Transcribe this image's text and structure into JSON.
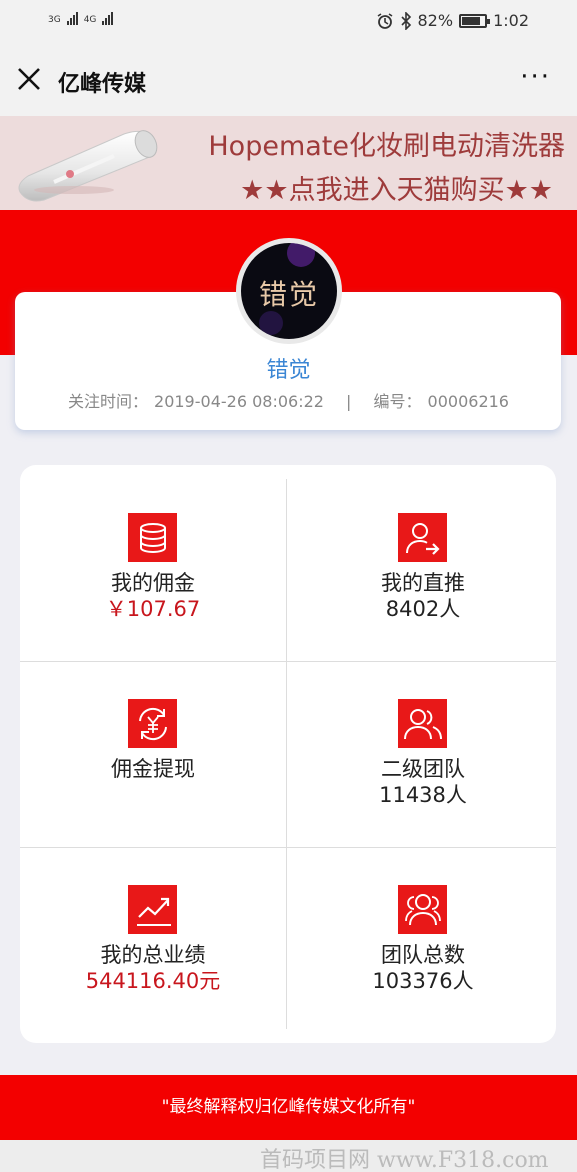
{
  "status_bar": {
    "network_1": "3G",
    "network_2": "4G",
    "battery": "82%",
    "battery_level": 0.82,
    "time": "1:02"
  },
  "nav": {
    "title": "亿峰传媒",
    "more": "···"
  },
  "banner": {
    "line1": "Hopemate化妆刷电动清洗器",
    "line2": "★★点我进入天猫购买★★"
  },
  "profile": {
    "avatar_text": "错觉",
    "name": "错觉",
    "follow_label": "关注时间：",
    "follow_time": "2019-04-26 08:06:22",
    "separator": "|",
    "id_label": "编号：",
    "id_value": "00006216"
  },
  "grid": {
    "items": [
      {
        "label": "我的佣金",
        "value": "￥107.67",
        "icon": "coins-icon"
      },
      {
        "label": "我的直推",
        "value": "8402人",
        "icon": "user-arrow-icon"
      },
      {
        "label": "佣金提现",
        "value": "",
        "icon": "yuan-refresh-icon"
      },
      {
        "label": "二级团队",
        "value": "11438人",
        "icon": "two-users-icon"
      },
      {
        "label": "我的总业绩",
        "value": "544116.40元",
        "icon": "trend-chart-icon"
      },
      {
        "label": "团队总数",
        "value": "103376人",
        "icon": "group-icon"
      }
    ]
  },
  "footer": {
    "text": "\"最终解释权归亿峰传媒文化所有\""
  },
  "watermark": {
    "text": "首码项目网 www.F318.com"
  },
  "colors": {
    "brand_red": "#f30000",
    "value_red": "#c8161d",
    "name_blue": "#3b86d4"
  }
}
